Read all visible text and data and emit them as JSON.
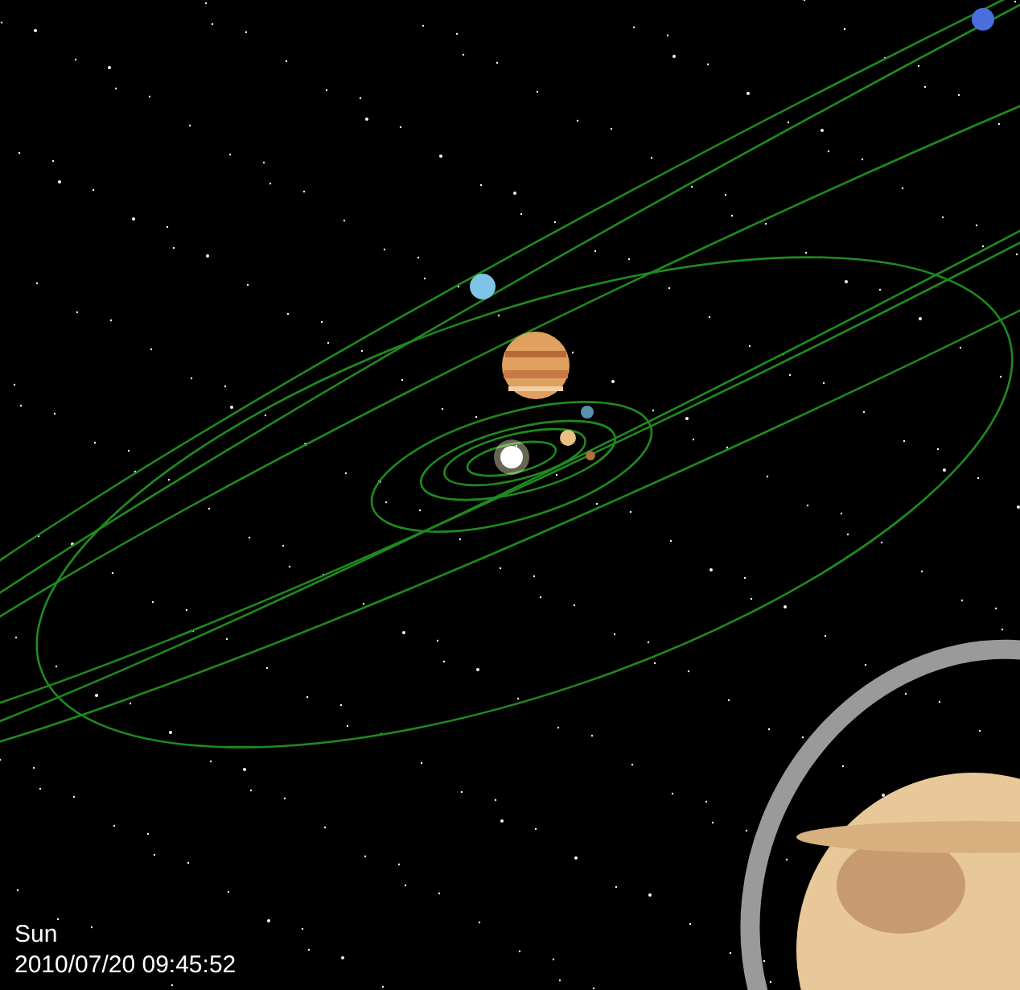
{
  "selected_object": "Sun",
  "datetime": "2010/07/20 09:45:52"
}
